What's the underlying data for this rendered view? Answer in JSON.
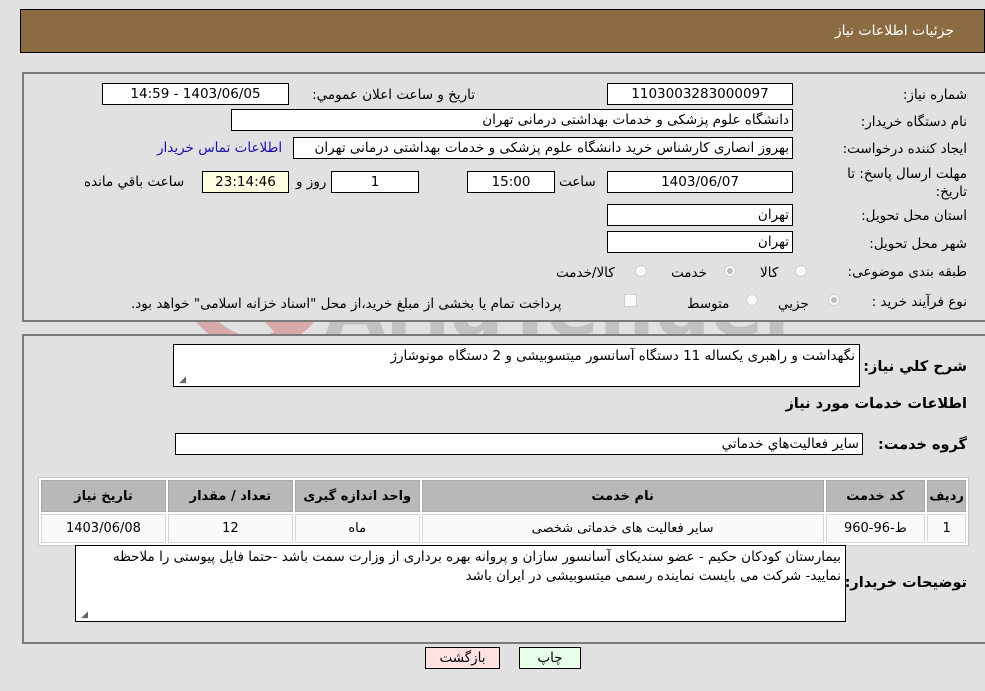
{
  "header": {
    "title": "جزئیات اطلاعات نیاز"
  },
  "form": {
    "need_number": {
      "label": "شماره نیاز:",
      "value": "1103003283000097"
    },
    "announce_datetime": {
      "label": "تاريخ و ساعت اعلان عمومي:",
      "value": "1403/06/05 - 14:59"
    },
    "buyer_org": {
      "label": "نام دستگاه خريدار:",
      "value": "دانشگاه علوم پزشکی و خدمات بهداشتی درمانی تهران"
    },
    "requester": {
      "label": "ايجاد کننده درخواست:",
      "value": "بهروز انصاری کارشناس خرید دانشگاه علوم پزشکی و خدمات بهداشتی درمانی تهران"
    },
    "buyer_contact_link": "اطلاعات تماس خريدار",
    "deadline": {
      "label": "مهلت ارسال پاسخ: تا تاريخ:",
      "date": "1403/06/07",
      "time_label": "ساعت",
      "time": "15:00",
      "days": "1",
      "days_label": "روز و",
      "remaining": "23:14:46",
      "remaining_label": "ساعت باقي مانده"
    },
    "province": {
      "label": "استان محل تحويل:",
      "value": "تهران"
    },
    "city": {
      "label": "شهر محل تحويل:",
      "value": "تهران"
    },
    "category": {
      "label": "طبقه بندی موضوعی:",
      "options": [
        "کالا",
        "خدمت",
        "کالا/خدمت"
      ],
      "selected": "خدمت"
    },
    "process_type": {
      "label": "نوع فرآيند خريد :",
      "options": [
        "جزيي",
        "متوسط"
      ],
      "selected": "جزيي",
      "treasury_note": "پرداخت تمام يا بخشی از مبلغ خريد،از محل \"اسناد خزانه اسلامی\" خواهد بود.",
      "treasury_checked": false
    }
  },
  "details": {
    "summary_label": "شرح کلي نياز:",
    "summary": "نگهداشت و راهبری یکساله 11 دستگاه آسانسور میتسوبیشی و 2 دستگاه مونوشارژ",
    "services_heading": "اطلاعات خدمات مورد نياز",
    "service_group_label": "گروه خدمت:",
    "service_group": "ساير فعاليت‌هاي خدماتي",
    "table": {
      "headers": [
        "رديف",
        "کد خدمت",
        "نام خدمت",
        "واحد اندازه گيری",
        "تعداد / مقدار",
        "تاريخ نياز"
      ],
      "rows": [
        [
          "1",
          "ط-96-960",
          "ساير فعاليت های خدماتی شخصی",
          "ماه",
          "12",
          "1403/06/08"
        ]
      ]
    },
    "buyer_notes_label": "توضيحات خريدار:",
    "buyer_notes": "بیمارستان کودکان حکیم - عضو سندیکای آسانسور سازان و پروانه بهره برداری از وزارت سمت باشد -حتما فایل پیوستی را ملاحظه نمایید- شرکت می بایست نماینده رسمی میتسوبیشی در ایران باشد"
  },
  "buttons": {
    "print": "چاپ",
    "back": "بازگشت"
  },
  "watermark": {
    "text": "AriaTender.neT"
  },
  "colors": {
    "header_bg": "#8b6c42",
    "link": "#1a0dab",
    "back_btn": "#ffe1e1",
    "print_btn": "#e8ffe8",
    "remaining_bg": "#ffffe1"
  }
}
